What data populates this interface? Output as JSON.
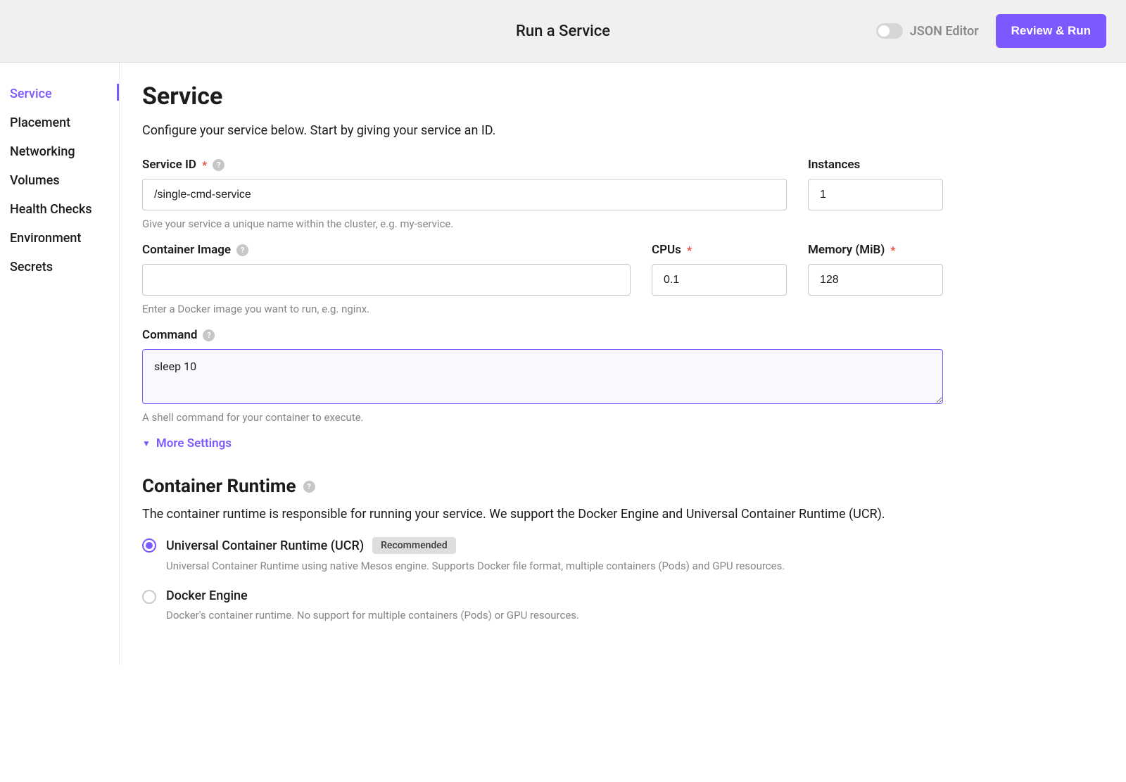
{
  "header": {
    "title": "Run a Service",
    "json_editor_label": "JSON Editor",
    "review_run_label": "Review & Run"
  },
  "sidebar": {
    "items": [
      {
        "label": "Service",
        "active": true
      },
      {
        "label": "Placement",
        "active": false
      },
      {
        "label": "Networking",
        "active": false
      },
      {
        "label": "Volumes",
        "active": false
      },
      {
        "label": "Health Checks",
        "active": false
      },
      {
        "label": "Environment",
        "active": false
      },
      {
        "label": "Secrets",
        "active": false
      }
    ]
  },
  "section": {
    "title": "Service",
    "description": "Configure your service below. Start by giving your service an ID."
  },
  "fields": {
    "service_id": {
      "label": "Service ID",
      "value": "/single-cmd-service",
      "helper": "Give your service a unique name within the cluster, e.g. my-service."
    },
    "instances": {
      "label": "Instances",
      "value": "1"
    },
    "container_image": {
      "label": "Container Image",
      "value": "",
      "helper": "Enter a Docker image you want to run, e.g. nginx."
    },
    "cpus": {
      "label": "CPUs",
      "value": "0.1"
    },
    "memory": {
      "label": "Memory (MiB)",
      "value": "128"
    },
    "command": {
      "label": "Command",
      "value": "sleep 10",
      "helper": "A shell command for your container to execute."
    }
  },
  "more_settings_label": "More Settings",
  "runtime": {
    "title": "Container Runtime",
    "description": "The container runtime is responsible for running your service. We support the Docker Engine and Universal Container Runtime (UCR).",
    "options": [
      {
        "label": "Universal Container Runtime (UCR)",
        "badge": "Recommended",
        "description": "Universal Container Runtime using native Mesos engine. Supports Docker file format, multiple containers (Pods) and GPU resources.",
        "selected": true
      },
      {
        "label": "Docker Engine",
        "badge": "",
        "description": "Docker's container runtime. No support for multiple containers (Pods) or GPU resources.",
        "selected": false
      }
    ]
  },
  "required_mark": "*",
  "help_mark": "?"
}
